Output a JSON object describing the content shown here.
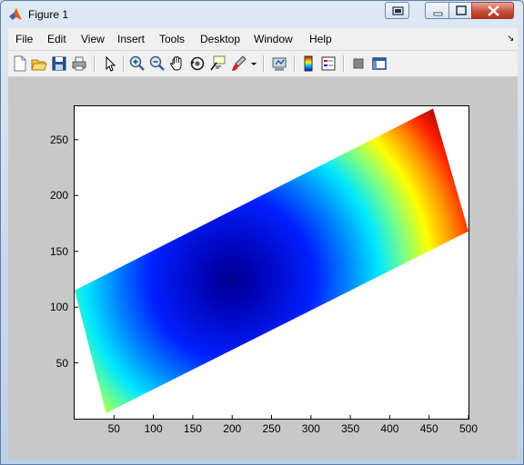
{
  "window": {
    "title": "Figure 1"
  },
  "menu": [
    "File",
    "Edit",
    "View",
    "Insert",
    "Tools",
    "Desktop",
    "Window",
    "Help"
  ],
  "toolbar_icons": [
    "new-figure-icon",
    "open-file-icon",
    "save-icon",
    "print-icon",
    "edit-plot-arrow-icon",
    "zoom-in-icon",
    "zoom-out-icon",
    "pan-hand-icon",
    "rotate-3d-icon",
    "data-cursor-icon",
    "brush-icon",
    "brush-dropdown-icon",
    "link-plot-icon",
    "insert-colorbar-icon",
    "insert-legend-icon",
    "hide-plot-tools-icon",
    "show-plot-tools-icon"
  ],
  "chart_data": {
    "type": "heatmap",
    "title": "",
    "xlabel": "",
    "ylabel": "",
    "xlim": [
      0,
      500
    ],
    "ylim": [
      0,
      280
    ],
    "xticks": [
      50,
      100,
      150,
      200,
      250,
      300,
      350,
      400,
      450,
      500
    ],
    "yticks": [
      50,
      100,
      150,
      200,
      250
    ],
    "colormap": "jet",
    "region_corners": [
      [
        0,
        115
      ],
      [
        455,
        278
      ],
      [
        500,
        168
      ],
      [
        40,
        5
      ]
    ],
    "minimum_center": [
      200,
      125
    ],
    "colors": {
      "low": "#00008f",
      "high": "#800000"
    }
  }
}
